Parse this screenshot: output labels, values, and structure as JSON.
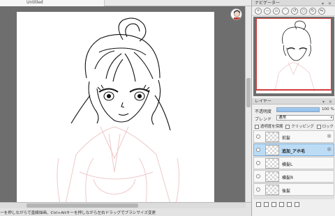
{
  "document": {
    "tab_title": "Untitled"
  },
  "status": {
    "hint": "ーを押しながらで直線描画、Ctrl+Altキーを押しながら左右ドラッグでブラシサイズ変更"
  },
  "navigator": {
    "title": "ナビゲーター",
    "tools": [
      "zoom-in-icon",
      "zoom-out-icon",
      "zoom-fit-icon",
      "zoom-reset-icon",
      "rotate-left-icon",
      "rotate-reset-icon",
      "rotate-right-icon",
      "flip-icon"
    ]
  },
  "layers_panel": {
    "title": "レイヤー",
    "opacity_label": "不透明度",
    "opacity_value": "100 %",
    "opacity_percent": 100,
    "blend_label": "ブレンド",
    "blend_value": "通常",
    "checkboxes": {
      "preserve_alpha": "透明度を保護",
      "clipping": "クリッピング",
      "lock": "ロック"
    },
    "layers": [
      {
        "name": "前髪",
        "active": false,
        "has_gear": true
      },
      {
        "name": "追加_アホ毛",
        "active": true,
        "has_gear": true
      },
      {
        "name": "横髪L",
        "active": false,
        "has_gear": false
      },
      {
        "name": "横髪R",
        "active": false,
        "has_gear": false
      },
      {
        "name": "後髪",
        "active": false,
        "has_gear": false
      }
    ]
  },
  "colors": {
    "accent": "#8ebde9",
    "nav_frame": "#d23a3a",
    "selected_layer": "#bcdcf6"
  }
}
